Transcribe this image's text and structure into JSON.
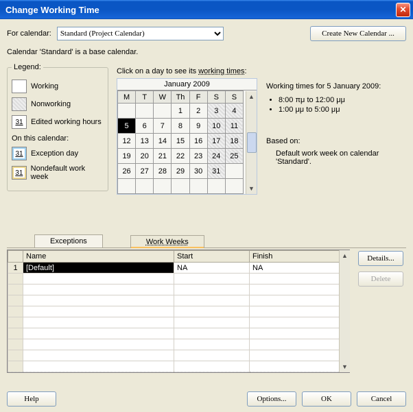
{
  "window": {
    "title": "Change Working Time",
    "close_icon": "✕"
  },
  "calendar_picker": {
    "label": "For calendar:",
    "selected": "Standard (Project Calendar)",
    "options": [
      "Standard (Project Calendar)"
    ],
    "new_button": "Create New Calendar ..."
  },
  "description": "Calendar 'Standard' is a base calendar.",
  "legend": {
    "title": "Legend:",
    "items": [
      {
        "swatch": "",
        "class": "sw-working",
        "label": "Working"
      },
      {
        "swatch": "",
        "class": "sw-nonworking",
        "label": "Nonworking"
      },
      {
        "swatch": "31",
        "class": "sw-edited",
        "label": "Edited working hours"
      }
    ],
    "subhead": "On this calendar:",
    "items2": [
      {
        "swatch": "31",
        "class": "sw-exception",
        "label": "Exception day"
      },
      {
        "swatch": "31",
        "class": "sw-nondefault",
        "label": "Nondefault work week"
      }
    ]
  },
  "calendar": {
    "caption_prefix": "Click on a day to see its ",
    "caption_underline": "working times",
    "caption_suffix": ":",
    "month": "January 2009",
    "dow": [
      "M",
      "T",
      "W",
      "Th",
      "F",
      "S",
      "S"
    ],
    "weeks": [
      [
        {
          "d": ""
        },
        {
          "d": ""
        },
        {
          "d": ""
        },
        {
          "d": "1"
        },
        {
          "d": "2"
        },
        {
          "d": "3",
          "nw": true
        },
        {
          "d": "4",
          "nw": true
        }
      ],
      [
        {
          "d": "5",
          "sel": true
        },
        {
          "d": "6"
        },
        {
          "d": "7"
        },
        {
          "d": "8"
        },
        {
          "d": "9"
        },
        {
          "d": "10",
          "nw": true
        },
        {
          "d": "11",
          "nw": true
        }
      ],
      [
        {
          "d": "12"
        },
        {
          "d": "13"
        },
        {
          "d": "14"
        },
        {
          "d": "15"
        },
        {
          "d": "16"
        },
        {
          "d": "17",
          "nw": true
        },
        {
          "d": "18",
          "nw": true
        }
      ],
      [
        {
          "d": "19"
        },
        {
          "d": "20"
        },
        {
          "d": "21"
        },
        {
          "d": "22"
        },
        {
          "d": "23"
        },
        {
          "d": "24",
          "nw": true
        },
        {
          "d": "25",
          "nw": true
        }
      ],
      [
        {
          "d": "26"
        },
        {
          "d": "27"
        },
        {
          "d": "28"
        },
        {
          "d": "29"
        },
        {
          "d": "30"
        },
        {
          "d": "31",
          "nw": true
        },
        {
          "d": ""
        }
      ],
      [
        {
          "d": ""
        },
        {
          "d": ""
        },
        {
          "d": ""
        },
        {
          "d": ""
        },
        {
          "d": ""
        },
        {
          "d": ""
        },
        {
          "d": ""
        }
      ]
    ]
  },
  "working_times_panel": {
    "heading": "Working times for 5 January 2009:",
    "times": [
      "8:00 πμ to 12:00 μμ",
      "1:00 μμ to 5:00 μμ"
    ],
    "based_on_label": "Based on:",
    "based_on_text": "Default work week on calendar 'Standard'."
  },
  "tabs": {
    "exceptions": "Exceptions",
    "work_weeks": "Work Weeks"
  },
  "grid": {
    "headers": {
      "rownum": "",
      "name": "Name",
      "start": "Start",
      "finish": "Finish"
    },
    "rows": [
      {
        "n": "1",
        "name": "[Default]",
        "start": "NA",
        "finish": "NA",
        "selected": true
      },
      {
        "n": "",
        "name": "",
        "start": "",
        "finish": ""
      },
      {
        "n": "",
        "name": "",
        "start": "",
        "finish": ""
      },
      {
        "n": "",
        "name": "",
        "start": "",
        "finish": ""
      },
      {
        "n": "",
        "name": "",
        "start": "",
        "finish": ""
      },
      {
        "n": "",
        "name": "",
        "start": "",
        "finish": ""
      },
      {
        "n": "",
        "name": "",
        "start": "",
        "finish": ""
      },
      {
        "n": "",
        "name": "",
        "start": "",
        "finish": ""
      },
      {
        "n": "",
        "name": "",
        "start": "",
        "finish": ""
      },
      {
        "n": "",
        "name": "",
        "start": "",
        "finish": ""
      }
    ],
    "side_buttons": {
      "details": "Details...",
      "delete": "Delete"
    }
  },
  "bottom_buttons": {
    "help": "Help",
    "options": "Options...",
    "ok": "OK",
    "cancel": "Cancel"
  },
  "glyphs": {
    "up": "▲",
    "down": "▼"
  }
}
